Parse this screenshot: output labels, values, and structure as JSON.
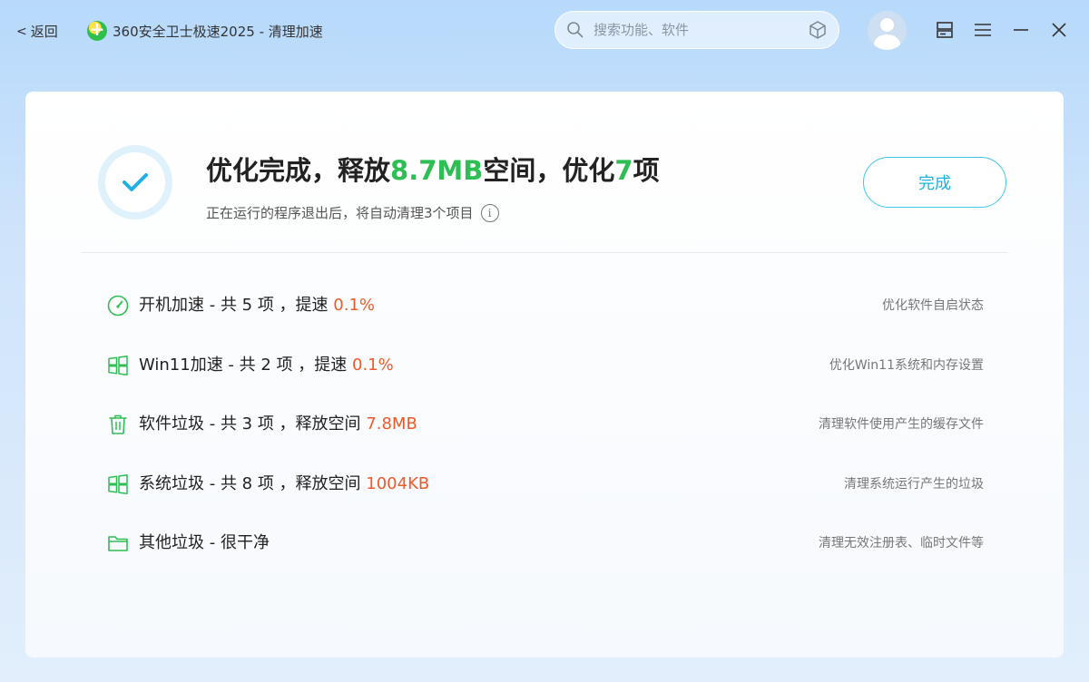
{
  "titlebar": {
    "back_label": "返回",
    "app_title": "360安全卫士极速2025 - 清理加速"
  },
  "search": {
    "placeholder": "搜索功能、软件"
  },
  "result": {
    "prefix": "优化完成，释放",
    "space": "8.7MB",
    "middle": "空间，优化",
    "count": "7",
    "suffix": "项",
    "subtitle": "正在运行的程序退出后，将自动清理3个项目",
    "done_label": "完成"
  },
  "items": [
    {
      "icon": "speedometer-icon",
      "label": "开机加速 - 共 5 项 ，提速 ",
      "value": "0.1%",
      "desc": "优化软件自启状态"
    },
    {
      "icon": "windows-icon",
      "label": "Win11加速 - 共 2 项 ，提速 ",
      "value": "0.1%",
      "desc": "优化Win11系统和内存设置"
    },
    {
      "icon": "trash-icon",
      "label": "软件垃圾 - 共 3 项 ，释放空间 ",
      "value": "7.8MB",
      "desc": "清理软件使用产生的缓存文件"
    },
    {
      "icon": "windows-icon",
      "label": "系统垃圾 - 共 8 项 ，释放空间 ",
      "value": "1004KB",
      "desc": "清理系统运行产生的垃圾"
    },
    {
      "icon": "folder-icon",
      "label": "其他垃圾 - 很干净",
      "value": "",
      "desc": "清理无效注册表、临时文件等"
    }
  ],
  "colors": {
    "accent_green": "#2ebe53",
    "highlight_orange": "#f05a2a",
    "button_cyan": "#1fb3d9"
  }
}
